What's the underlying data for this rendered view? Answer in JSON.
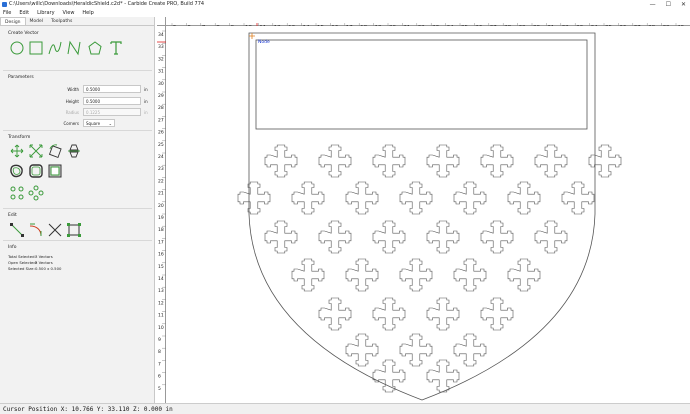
{
  "window": {
    "title": "C:\\Users\\willc\\Downloads\\HeraldicShield.c2d* - Carbide Create PRO, Build 774",
    "controls": [
      "—",
      "☐",
      "✕"
    ]
  },
  "menu": [
    "File",
    "Edit",
    "Library",
    "View",
    "Help"
  ],
  "tabs": [
    "Design",
    "Model",
    "Toolpaths"
  ],
  "create_vector": {
    "title": "Create Vector",
    "tools": [
      "circle-icon",
      "rectangle-icon",
      "curve-icon",
      "polyline-icon",
      "polygon-icon",
      "text-icon"
    ]
  },
  "parameters": {
    "title": "Parameters",
    "width": {
      "label": "Width",
      "value": "0.5000",
      "unit": "in"
    },
    "height": {
      "label": "Height",
      "value": "0.5000",
      "unit": "in"
    },
    "radius": {
      "label": "Radius",
      "value": "0.1225",
      "unit": "in"
    },
    "corners": {
      "label": "Corners",
      "value": "Square"
    }
  },
  "transform": {
    "title": "Transform",
    "tools": [
      "move-icon",
      "scale-icon",
      "rotate-icon",
      "mirror-icon",
      "offset-icon",
      "boolean-icon",
      "align-icon",
      "array-icon",
      "circular-array-icon"
    ]
  },
  "edit": {
    "title": "Edit",
    "tools": [
      "node-edit-icon",
      "fillet-icon",
      "trim-icon",
      "bounding-box-icon"
    ]
  },
  "info": {
    "title": "Info",
    "rows": [
      {
        "label": "Total Selected:",
        "value": "3 Vectors"
      },
      {
        "label": "Open Selected:",
        "value": "3 Vectors"
      },
      {
        "label": "Selected Size:",
        "value": "0.500 x 0.500"
      }
    ]
  },
  "ruler": {
    "top_labels": [
      "5",
      "6",
      "7",
      "8",
      "9",
      "10",
      "11",
      "12",
      "13",
      "14",
      "15",
      "16",
      "17",
      "18",
      "19",
      "20",
      "21",
      "22",
      "23",
      "24",
      "25",
      "26",
      "27",
      "28",
      "29",
      "30",
      "31",
      "32",
      "33",
      "34",
      "35",
      "36",
      "37",
      "38",
      "39",
      "40"
    ],
    "left_labels": [
      "34",
      "33",
      "32",
      "31",
      "30",
      "29",
      "28",
      "27",
      "26",
      "25",
      "24",
      "23",
      "22",
      "21",
      "20",
      "19",
      "18",
      "17",
      "16",
      "15",
      "14",
      "13",
      "12",
      "11",
      "10",
      "9",
      "8",
      "7",
      "6",
      "5"
    ]
  },
  "canvas": {
    "node_label": "Node"
  },
  "status": {
    "text": "Cursor Position X: 10.766 Y: 33.110 Z: 0.000 in"
  },
  "colors": {
    "accent_green": "#3a9a3a",
    "crosshair_red": "#e02020",
    "node_blue": "#1030d0",
    "vector_line": "#555555"
  }
}
